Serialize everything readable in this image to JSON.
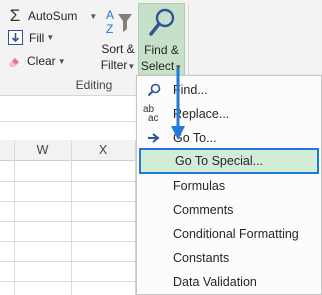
{
  "ribbon": {
    "autosum": {
      "label": "AutoSum",
      "icon": "sigma-icon"
    },
    "fill": {
      "label": "Fill",
      "icon": "fill-down-icon"
    },
    "clear": {
      "label": "Clear",
      "icon": "eraser-icon"
    },
    "sort_filter": {
      "line1": "Sort &",
      "line2": "Filter",
      "icon": "sort-filter-icon"
    },
    "find_select": {
      "line1": "Find &",
      "line2": "Select",
      "icon": "magnifier-icon",
      "bg_color": "#c6e0c9"
    },
    "group_label": "Editing"
  },
  "grid": {
    "columns": [
      "W",
      "X"
    ]
  },
  "menu": {
    "items": [
      {
        "label": "Find...",
        "icon": "search-icon"
      },
      {
        "label": "Replace...",
        "icon": "replace-icon"
      },
      {
        "label": "Go To...",
        "icon": "arrow-right-icon"
      },
      {
        "label": "Go To Special...",
        "icon": "",
        "highlighted": true
      },
      {
        "label": "Formulas",
        "icon": ""
      },
      {
        "label": "Comments",
        "icon": ""
      },
      {
        "label": "Conditional Formatting",
        "icon": ""
      },
      {
        "label": "Constants",
        "icon": ""
      },
      {
        "label": "Data Validation",
        "icon": ""
      }
    ],
    "highlight_color": "#d3ecd8",
    "highlight_border": "#1f7ad8"
  },
  "colors": {
    "accent_arrow": "#1f7ad8"
  }
}
